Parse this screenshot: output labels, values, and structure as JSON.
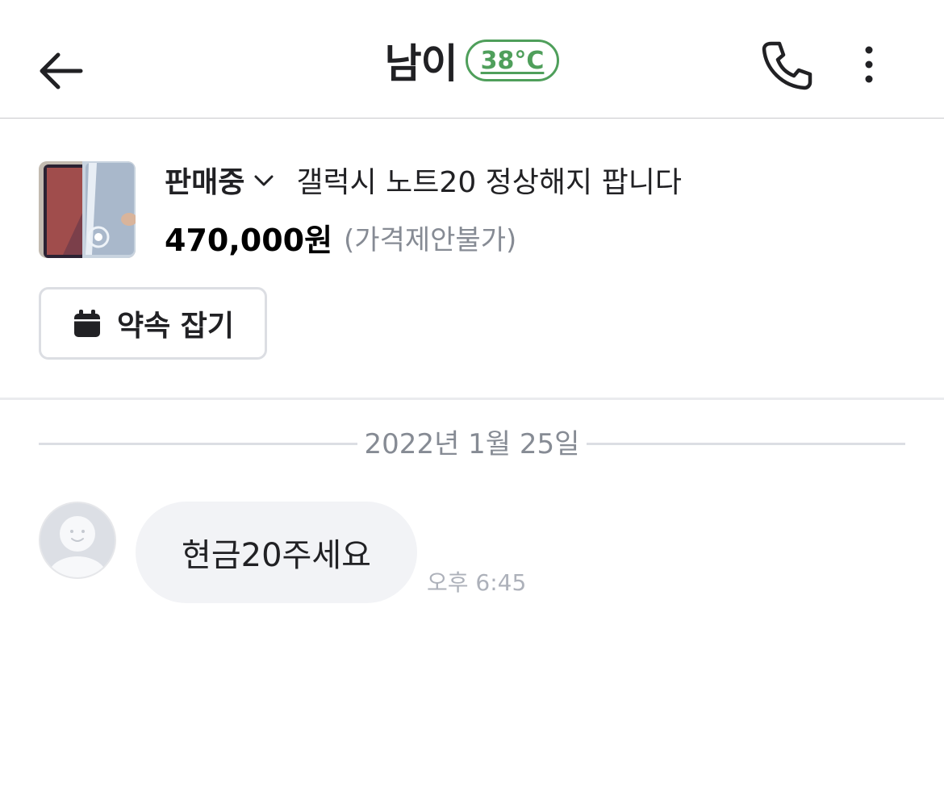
{
  "header": {
    "back_icon": "arrow-left-icon",
    "title": "남이",
    "temperature": "38°C",
    "temperature_color": "#4f9f5b",
    "phone_icon": "phone-icon",
    "more_icon": "more-vertical-icon"
  },
  "product": {
    "status": "판매중",
    "status_icon": "chevron-down-icon",
    "title": "갤럭시 노트20 정상해지 팝니다",
    "price": "470,000원",
    "price_note": "(가격제안불가)",
    "appointment_icon": "calendar-icon",
    "appointment_label": "약속 잡기"
  },
  "chat": {
    "date_separator": "2022년 1월 25일",
    "messages": [
      {
        "avatar_icon": "default-avatar-icon",
        "text": "현금20주세요",
        "time": "오후 6:45"
      }
    ]
  }
}
